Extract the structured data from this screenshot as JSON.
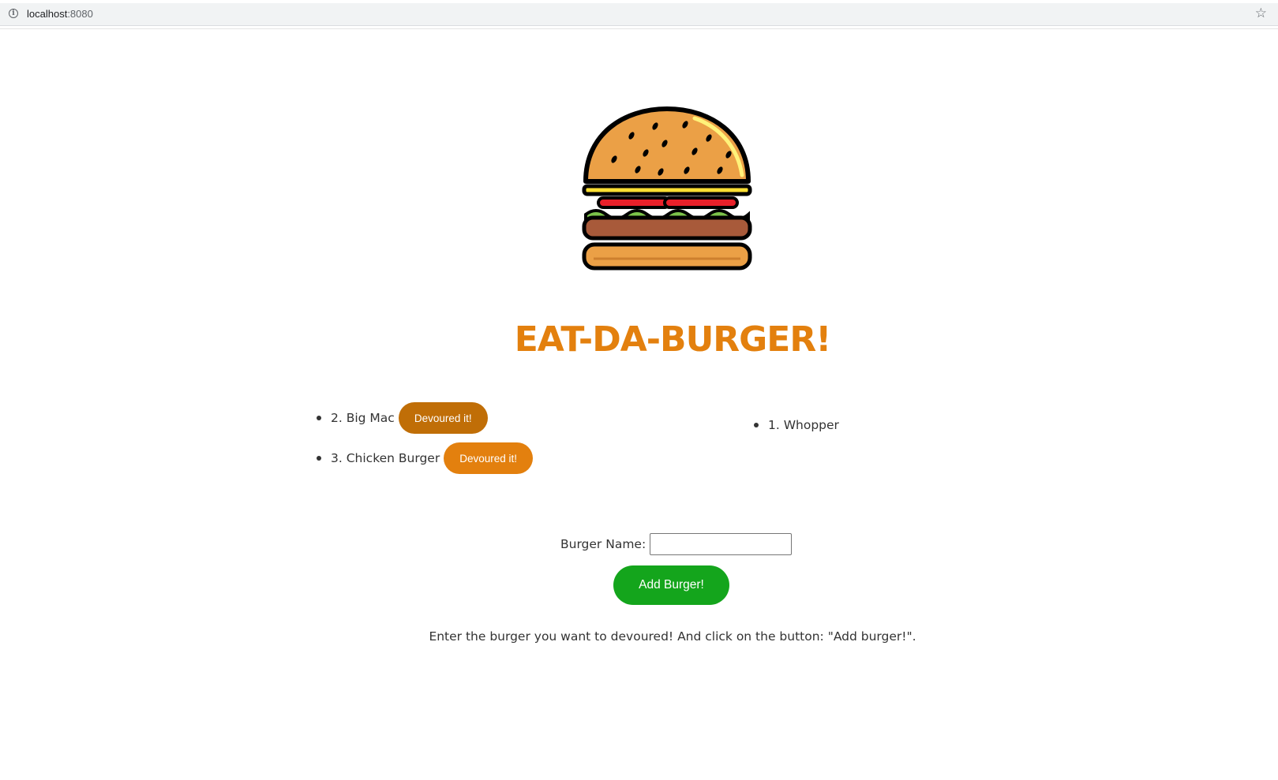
{
  "browser": {
    "url_host": "localhost",
    "url_port": ":8080"
  },
  "page": {
    "title": "EAT-DA-BURGER!",
    "logo": "burger-logo"
  },
  "burgers_to_eat": [
    {
      "label": "2. Big Mac",
      "button": "Devoured it!"
    },
    {
      "label": "3. Chicken Burger",
      "button": "Devoured it!"
    }
  ],
  "burgers_devoured": [
    {
      "label": "1. Whopper"
    }
  ],
  "form": {
    "label": "Burger Name:",
    "value": "",
    "submit_label": "Add Burger!"
  },
  "instructions": "Enter the burger you want to devoured! And click on the button: \"Add burger!\".",
  "colors": {
    "accent": "#e3800e",
    "accent_dark": "#c06e07",
    "add_button": "#14a51c"
  }
}
